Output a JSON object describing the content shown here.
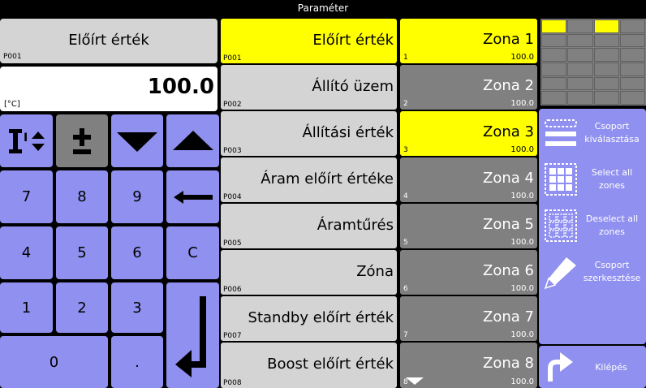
{
  "window": {
    "title": "Paraméter"
  },
  "current_param": {
    "name": "Előírt érték",
    "code": "P001"
  },
  "value_display": {
    "value": "100.0",
    "unit": "[°C]"
  },
  "keypad": {
    "k7": "7",
    "k8": "8",
    "k9": "9",
    "k4": "4",
    "k5": "5",
    "k6": "6",
    "clear": "C",
    "k1": "1",
    "k2": "2",
    "k3": "3",
    "k0": "0",
    "dot": "."
  },
  "parameters": [
    {
      "label": "Előírt érték",
      "code": "P001",
      "selected": true
    },
    {
      "label": "Állító üzem",
      "code": "P002",
      "selected": false
    },
    {
      "label": "Állítási érték",
      "code": "P003",
      "selected": false
    },
    {
      "label": "Áram előírt értéke",
      "code": "P004",
      "selected": false
    },
    {
      "label": "Áramtűrés",
      "code": "P005",
      "selected": false
    },
    {
      "label": "Zóna",
      "code": "P006",
      "selected": false
    },
    {
      "label": "Standby előírt érték",
      "code": "P007",
      "selected": false
    },
    {
      "label": "Boost előírt érték",
      "code": "P008",
      "selected": false
    }
  ],
  "zones": [
    {
      "name": "Zona 1",
      "index": "1",
      "value": "100.0",
      "selected": true
    },
    {
      "name": "Zona 2",
      "index": "2",
      "value": "100.0",
      "selected": false
    },
    {
      "name": "Zona 3",
      "index": "3",
      "value": "100.0",
      "selected": true
    },
    {
      "name": "Zona 4",
      "index": "4",
      "value": "100.0",
      "selected": false
    },
    {
      "name": "Zona 5",
      "index": "5",
      "value": "100.0",
      "selected": false
    },
    {
      "name": "Zona 6",
      "index": "6",
      "value": "100.0",
      "selected": false
    },
    {
      "name": "Zona 7",
      "index": "7",
      "value": "100.0",
      "selected": false
    },
    {
      "name": "Zona 8",
      "index": "8",
      "value": "100.0",
      "selected": false
    }
  ],
  "side_buttons": {
    "group_select": "Csoport kiválasztása",
    "select_all": "Select all zones",
    "deselect_all": "Deselect all zones",
    "group_edit": "Csoport szerkesztése",
    "exit": "Kilépés"
  },
  "colors": {
    "selected": "#ffff00",
    "unselected_zone": "#808080",
    "button_blue": "#9090f0",
    "row_gray": "#d4d4d4"
  }
}
